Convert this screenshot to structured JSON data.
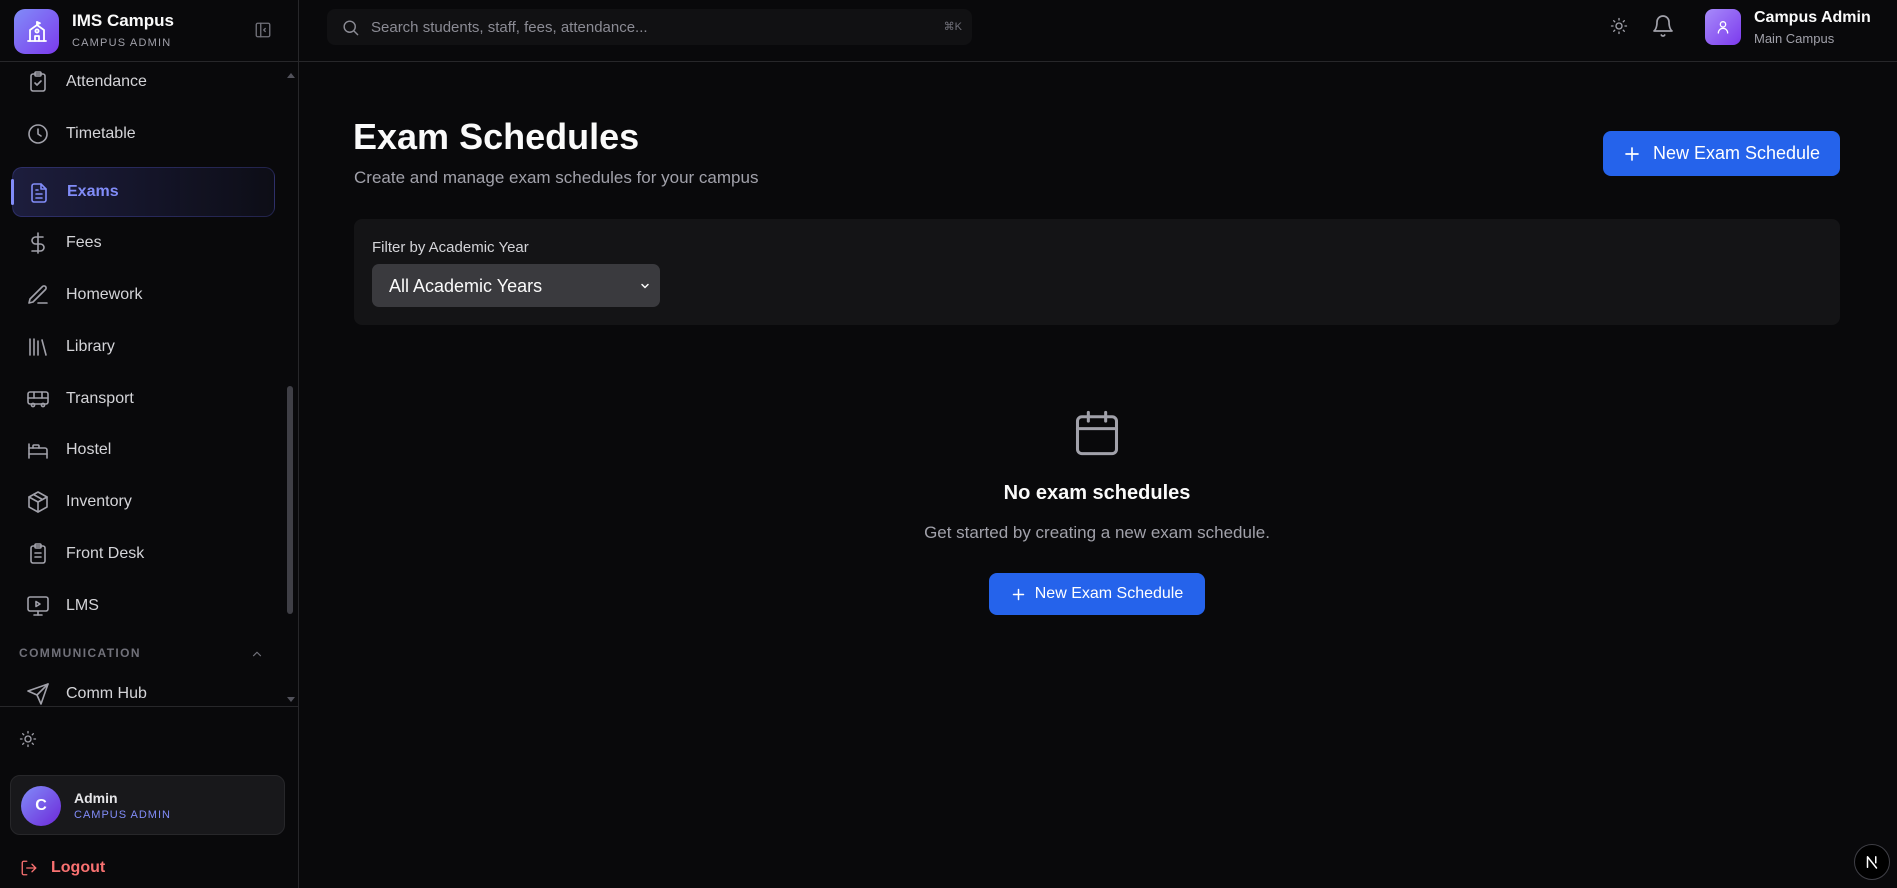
{
  "brand": {
    "name": "IMS Campus",
    "role": "CAMPUS ADMIN"
  },
  "sidebar": {
    "items": [
      {
        "label": "Attendance",
        "icon": "clipboard-check-icon"
      },
      {
        "label": "Timetable",
        "icon": "clock-icon"
      },
      {
        "label": "Exams",
        "icon": "file-text-icon",
        "active": true
      },
      {
        "label": "Fees",
        "icon": "dollar-icon"
      },
      {
        "label": "Homework",
        "icon": "pen-icon"
      },
      {
        "label": "Library",
        "icon": "library-icon"
      },
      {
        "label": "Transport",
        "icon": "bus-icon"
      },
      {
        "label": "Hostel",
        "icon": "bed-icon"
      },
      {
        "label": "Inventory",
        "icon": "package-icon"
      },
      {
        "label": "Front Desk",
        "icon": "clipboard-list-icon"
      },
      {
        "label": "LMS",
        "icon": "monitor-play-icon"
      }
    ],
    "section_communication": "COMMUNICATION",
    "comm_items": [
      {
        "label": "Comm Hub",
        "icon": "send-icon"
      }
    ]
  },
  "profile": {
    "initial": "C",
    "name": "Admin",
    "role": "CAMPUS ADMIN"
  },
  "logout_label": "Logout",
  "topbar": {
    "search_placeholder": "Search students, staff, fees, attendance...",
    "shortcut": "⌘K",
    "user_name": "Campus Admin",
    "user_campus": "Main Campus"
  },
  "page": {
    "title": "Exam Schedules",
    "subtitle": "Create and manage exam schedules for your campus",
    "new_button": "New Exam Schedule"
  },
  "filter": {
    "label": "Filter by Academic Year",
    "selected": "All Academic Years"
  },
  "empty_state": {
    "title": "No exam schedules",
    "subtitle": "Get started by creating a new exam schedule.",
    "button": "New Exam Schedule"
  },
  "colors": {
    "accent": "#2563eb",
    "active_nav": "#818cf8",
    "logout": "#f87171",
    "background": "#09090b"
  }
}
